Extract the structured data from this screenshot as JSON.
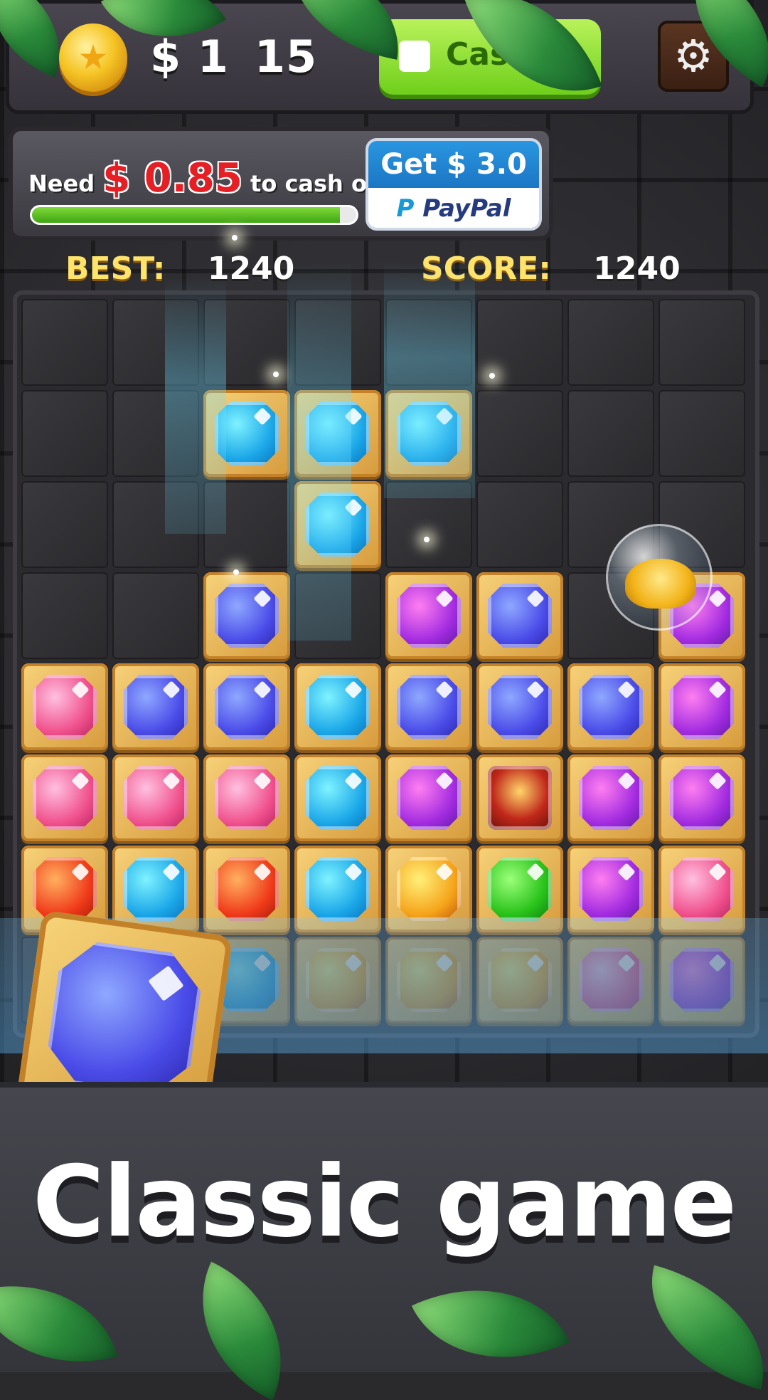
{
  "header": {
    "balance": "$ 1  15",
    "cash_out_label": "Cash",
    "settings_icon": "gear-icon"
  },
  "cashout": {
    "need_prefix": "Need",
    "need_amount": "$ 0.85",
    "need_suffix": "to cash out.",
    "progress_fraction": 0.95,
    "get_label": "Get $ 3.0",
    "paypal_label": "PayPal"
  },
  "scores": {
    "best_label": "BEST:",
    "best_value": "1240",
    "score_label": "SCORE:",
    "score_value": "1240"
  },
  "board": {
    "rows": 8,
    "cols": 8,
    "tiles": [
      {
        "r": 1,
        "c": 2,
        "color": "cyan"
      },
      {
        "r": 1,
        "c": 3,
        "color": "cyan"
      },
      {
        "r": 1,
        "c": 4,
        "color": "cyan"
      },
      {
        "r": 2,
        "c": 3,
        "color": "cyan"
      },
      {
        "r": 3,
        "c": 2,
        "color": "blue"
      },
      {
        "r": 3,
        "c": 4,
        "color": "purple"
      },
      {
        "r": 3,
        "c": 5,
        "color": "blue"
      },
      {
        "r": 3,
        "c": 7,
        "color": "purple"
      },
      {
        "r": 4,
        "c": 0,
        "color": "pink"
      },
      {
        "r": 4,
        "c": 1,
        "color": "blue"
      },
      {
        "r": 4,
        "c": 2,
        "color": "blue"
      },
      {
        "r": 4,
        "c": 3,
        "color": "cyan"
      },
      {
        "r": 4,
        "c": 4,
        "color": "blue"
      },
      {
        "r": 4,
        "c": 5,
        "color": "blue"
      },
      {
        "r": 4,
        "c": 6,
        "color": "blue"
      },
      {
        "r": 4,
        "c": 7,
        "color": "purple"
      },
      {
        "r": 5,
        "c": 0,
        "color": "pink"
      },
      {
        "r": 5,
        "c": 1,
        "color": "pink"
      },
      {
        "r": 5,
        "c": 2,
        "color": "pink"
      },
      {
        "r": 5,
        "c": 3,
        "color": "cyan"
      },
      {
        "r": 5,
        "c": 4,
        "color": "purple"
      },
      {
        "r": 5,
        "c": 5,
        "color": "chest"
      },
      {
        "r": 5,
        "c": 6,
        "color": "purple"
      },
      {
        "r": 5,
        "c": 7,
        "color": "purple"
      },
      {
        "r": 6,
        "c": 0,
        "color": "red"
      },
      {
        "r": 6,
        "c": 1,
        "color": "cyan"
      },
      {
        "r": 6,
        "c": 2,
        "color": "red"
      },
      {
        "r": 6,
        "c": 3,
        "color": "cyan"
      },
      {
        "r": 6,
        "c": 4,
        "color": "orange"
      },
      {
        "r": 6,
        "c": 5,
        "color": "green"
      },
      {
        "r": 6,
        "c": 6,
        "color": "purple"
      },
      {
        "r": 6,
        "c": 7,
        "color": "pink"
      },
      {
        "r": 7,
        "c": 2,
        "color": "cyan",
        "faded": true
      },
      {
        "r": 7,
        "c": 3,
        "color": "orange",
        "faded": true
      },
      {
        "r": 7,
        "c": 4,
        "color": "orange",
        "faded": true
      },
      {
        "r": 7,
        "c": 5,
        "color": "orange",
        "faded": true
      },
      {
        "r": 7,
        "c": 6,
        "color": "pink",
        "faded": true
      },
      {
        "r": 7,
        "c": 7,
        "color": "purple",
        "faded": true
      }
    ],
    "bonus_item": "coin-bubble"
  },
  "held_piece": {
    "color": "blue"
  },
  "banner": {
    "headline": "Classic game"
  }
}
